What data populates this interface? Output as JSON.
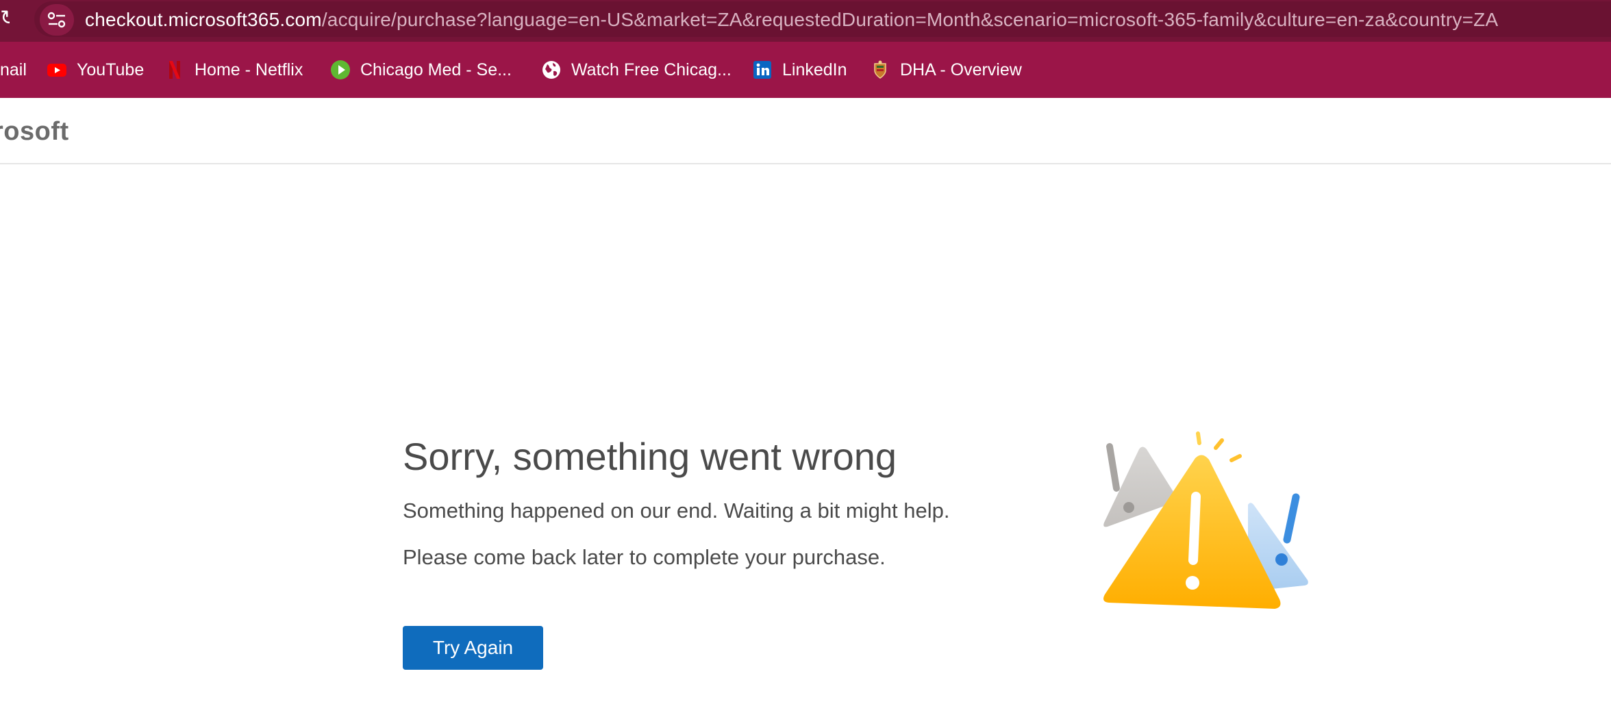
{
  "browser": {
    "url_domain": "checkout.microsoft365.com",
    "url_path": "/acquire/purchase?language=en-US&market=ZA&requestedDuration=Month&scenario=microsoft-365-family&culture=en-za&country=ZA",
    "bookmarks": [
      {
        "label": "nail",
        "icon": "gmail-icon"
      },
      {
        "label": "YouTube",
        "icon": "youtube-icon"
      },
      {
        "label": "Home - Netflix",
        "icon": "netflix-icon"
      },
      {
        "label": "Chicago Med - Se...",
        "icon": "play-icon"
      },
      {
        "label": "Watch Free Chicag...",
        "icon": "globe-icon"
      },
      {
        "label": "LinkedIn",
        "icon": "linkedin-icon"
      },
      {
        "label": "DHA - Overview",
        "icon": "dha-crest-icon"
      }
    ],
    "colors": {
      "toolbar": "#9b1548",
      "url_bar": "#741437"
    }
  },
  "header": {
    "brand": "rosoft"
  },
  "error": {
    "title": "Sorry, something went wrong",
    "line1": "Something happened on our end. Waiting a bit might help.",
    "line2": "Please come back later to complete your purchase.",
    "button_label": "Try Again",
    "illustration_icon": "warning-triangles-icon",
    "colors": {
      "button": "#0f6cbd",
      "warning": "#ffb900"
    }
  }
}
